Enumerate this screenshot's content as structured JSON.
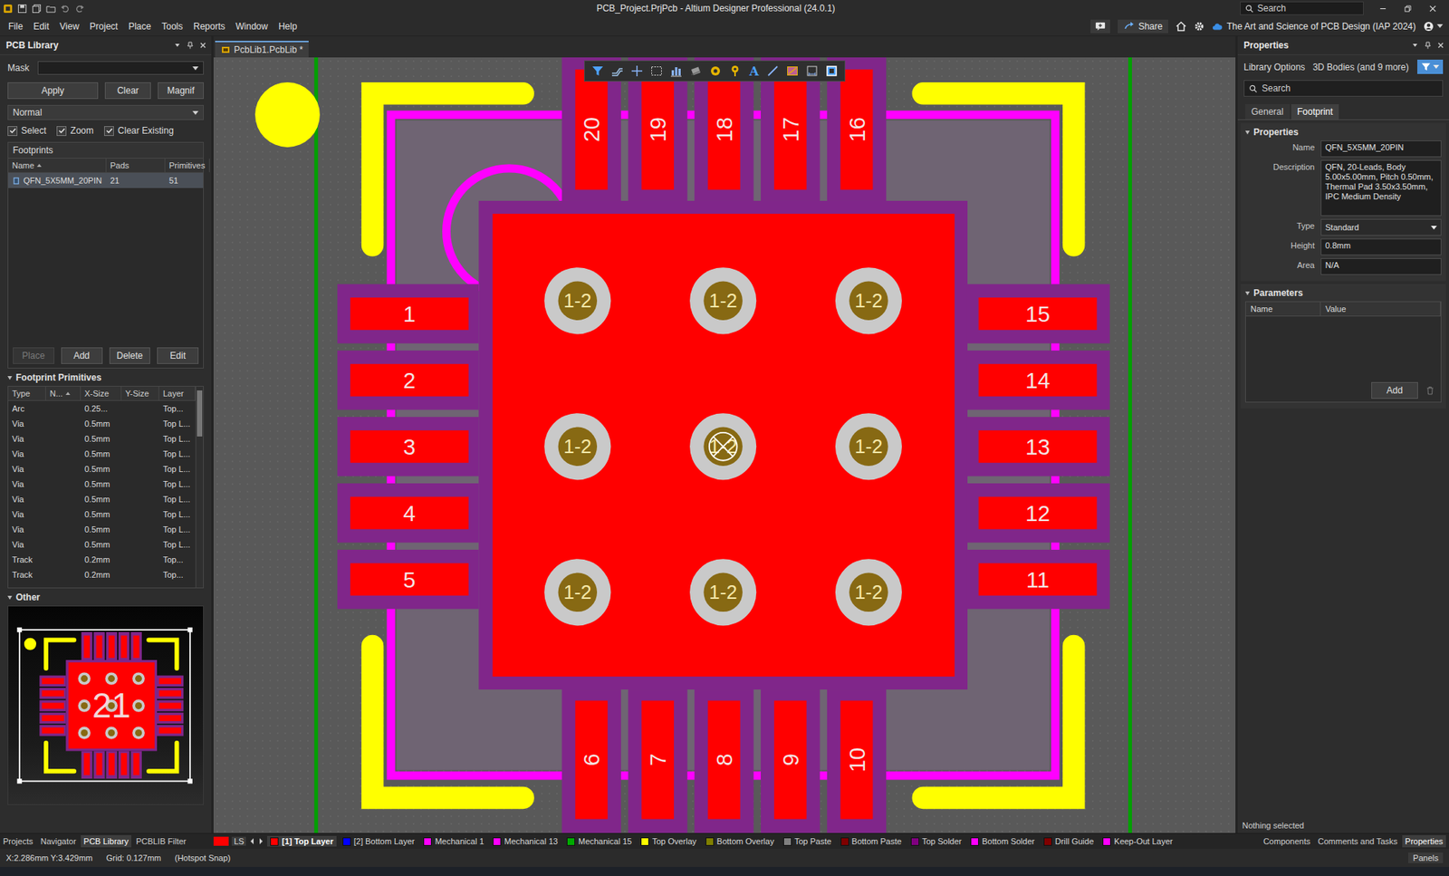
{
  "window": {
    "title": "PCB_Project.PrjPcb - Altium Designer Professional (24.0.1)",
    "search_placeholder": "Search"
  },
  "menu": [
    "File",
    "Edit",
    "View",
    "Project",
    "Place",
    "Tools",
    "Reports",
    "Window",
    "Help"
  ],
  "menu_right": {
    "share": "Share",
    "workspace": "The Art and Science of PCB Design (IAP 2024)"
  },
  "left_panel": {
    "title": "PCB Library",
    "mask_label": "Mask",
    "mask_value": "",
    "buttons": [
      "Apply",
      "Clear",
      "Magnif"
    ],
    "mode": "Normal",
    "options": [
      {
        "label": "Select",
        "checked": true
      },
      {
        "label": "Zoom",
        "checked": true
      },
      {
        "label": "Clear Existing",
        "checked": true
      }
    ],
    "footprints": {
      "title": "Footprints",
      "columns": [
        {
          "label": "Name",
          "sorted": true
        },
        {
          "label": "Pads",
          "sorted": false
        },
        {
          "label": "Primitives",
          "sorted": false
        }
      ],
      "rows": [
        {
          "name": "QFN_5X5MM_20PIN",
          "pads": "21",
          "primitives": "51",
          "selected": true
        }
      ],
      "buttons": [
        {
          "label": "Place",
          "disabled": true
        },
        {
          "label": "Add",
          "disabled": false
        },
        {
          "label": "Delete",
          "disabled": false
        },
        {
          "label": "Edit",
          "disabled": false
        }
      ]
    },
    "primitives": {
      "title": "Footprint Primitives",
      "columns": [
        {
          "label": "Type",
          "sorted": false
        },
        {
          "label": "N...",
          "sorted": true
        },
        {
          "label": "X-Size",
          "sorted": false
        },
        {
          "label": "Y-Size",
          "sorted": false
        },
        {
          "label": "Layer",
          "sorted": false
        }
      ],
      "rows": [
        {
          "type": "Arc",
          "name": "",
          "x_size": "0.25...",
          "y_size": "",
          "layer": "Top..."
        },
        {
          "type": "Via",
          "name": "",
          "x_size": "0.5mm",
          "y_size": "",
          "layer": "Top L..."
        },
        {
          "type": "Via",
          "name": "",
          "x_size": "0.5mm",
          "y_size": "",
          "layer": "Top L..."
        },
        {
          "type": "Via",
          "name": "",
          "x_size": "0.5mm",
          "y_size": "",
          "layer": "Top L..."
        },
        {
          "type": "Via",
          "name": "",
          "x_size": "0.5mm",
          "y_size": "",
          "layer": "Top L..."
        },
        {
          "type": "Via",
          "name": "",
          "x_size": "0.5mm",
          "y_size": "",
          "layer": "Top L..."
        },
        {
          "type": "Via",
          "name": "",
          "x_size": "0.5mm",
          "y_size": "",
          "layer": "Top L..."
        },
        {
          "type": "Via",
          "name": "",
          "x_size": "0.5mm",
          "y_size": "",
          "layer": "Top L..."
        },
        {
          "type": "Via",
          "name": "",
          "x_size": "0.5mm",
          "y_size": "",
          "layer": "Top L..."
        },
        {
          "type": "Via",
          "name": "",
          "x_size": "0.5mm",
          "y_size": "",
          "layer": "Top L..."
        },
        {
          "type": "Track",
          "name": "",
          "x_size": "0.2mm",
          "y_size": "",
          "layer": "Top..."
        },
        {
          "type": "Track",
          "name": "",
          "x_size": "0.2mm",
          "y_size": "",
          "layer": "Top..."
        }
      ],
      "scroll_position": 0.02,
      "scroll_visible_share": 0.23
    },
    "other_title": "Other"
  },
  "panel_tabs_left": [
    {
      "label": "Projects",
      "selected": false
    },
    {
      "label": "Navigator",
      "selected": false
    },
    {
      "label": "PCB Library",
      "selected": true
    },
    {
      "label": "PCBLIB Filter",
      "selected": false
    }
  ],
  "document_tabs": [
    {
      "label": "PcbLib1.PcbLib *",
      "selected": true
    }
  ],
  "canvas": {
    "text_tool": "A",
    "thermal_pad": "21",
    "pads": [
      {
        "number": "1",
        "side": "left"
      },
      {
        "number": "2",
        "side": "left"
      },
      {
        "number": "3",
        "side": "left"
      },
      {
        "number": "4",
        "side": "left"
      },
      {
        "number": "5",
        "side": "left"
      },
      {
        "number": "6",
        "side": "bottom"
      },
      {
        "number": "7",
        "side": "bottom"
      },
      {
        "number": "8",
        "side": "bottom"
      },
      {
        "number": "9",
        "side": "bottom"
      },
      {
        "number": "10",
        "side": "bottom"
      },
      {
        "number": "11",
        "side": "right"
      },
      {
        "number": "12",
        "side": "right"
      },
      {
        "number": "13",
        "side": "right"
      },
      {
        "number": "14",
        "side": "right"
      },
      {
        "number": "15",
        "side": "right"
      },
      {
        "number": "16",
        "side": "top"
      },
      {
        "number": "17",
        "side": "top"
      },
      {
        "number": "18",
        "side": "top"
      },
      {
        "number": "19",
        "side": "top"
      },
      {
        "number": "20",
        "side": "top"
      }
    ],
    "vias": [
      {
        "label": "1-2",
        "snapped": false
      },
      {
        "label": "1-2",
        "snapped": false
      },
      {
        "label": "1-2",
        "snapped": false
      },
      {
        "label": "1-2",
        "snapped": false
      },
      {
        "label": "1-2",
        "snapped": true
      },
      {
        "label": "1-2",
        "snapped": false
      },
      {
        "label": "1-2",
        "snapped": false
      },
      {
        "label": "1-2",
        "snapped": false
      },
      {
        "label": "1-2",
        "snapped": false
      }
    ]
  },
  "layer_bar": {
    "current_color": "#ff0000",
    "set_label": "LS",
    "layers": [
      {
        "label": "[1] Top Layer",
        "color": "#ff0000",
        "selected": true
      },
      {
        "label": "[2] Bottom Layer",
        "color": "#0000ff",
        "selected": false
      },
      {
        "label": "Mechanical 1",
        "color": "#ff00ff",
        "selected": false
      },
      {
        "label": "Mechanical 13",
        "color": "#ff00ff",
        "selected": false
      },
      {
        "label": "Mechanical 15",
        "color": "#00aa00",
        "selected": false
      },
      {
        "label": "Top Overlay",
        "color": "#ffff00",
        "selected": false
      },
      {
        "label": "Bottom Overlay",
        "color": "#808000",
        "selected": false
      },
      {
        "label": "Top Paste",
        "color": "#808080",
        "selected": false
      },
      {
        "label": "Bottom Paste",
        "color": "#800000",
        "selected": false
      },
      {
        "label": "Top Solder",
        "color": "#800080",
        "selected": false
      },
      {
        "label": "Bottom Solder",
        "color": "#ff00ff",
        "selected": false
      },
      {
        "label": "Drill Guide",
        "color": "#800000",
        "selected": false
      },
      {
        "label": "Keep-Out Layer",
        "color": "#ff00ff",
        "selected": false
      }
    ]
  },
  "right_panel": {
    "title": "Properties",
    "scope": "Library Options",
    "filter": "3D Bodies (and 9 more)",
    "search_placeholder": "Search",
    "tabs": [
      {
        "label": "General",
        "selected": false
      },
      {
        "label": "Footprint",
        "selected": true
      }
    ],
    "section": "Properties",
    "fields": [
      {
        "label": "Name",
        "value": "QFN_5X5MM_20PIN",
        "kind": "text"
      },
      {
        "label": "Description",
        "value": "QFN, 20-Leads, Body 5.00x5.00mm, Pitch 0.50mm, Thermal Pad 3.50x3.50mm, IPC Medium Density",
        "kind": "textarea"
      },
      {
        "label": "Type",
        "value": "Standard",
        "kind": "select"
      },
      {
        "label": "Height",
        "value": "0.8mm",
        "kind": "text"
      },
      {
        "label": "Area",
        "value": "N/A",
        "kind": "text"
      }
    ],
    "parameters": {
      "title": "Parameters",
      "columns": [
        "Name",
        "Value"
      ],
      "add": "Add"
    },
    "selection": "Nothing selected"
  },
  "panel_tabs_right": [
    {
      "label": "Components",
      "selected": false
    },
    {
      "label": "Comments and Tasks",
      "selected": false
    },
    {
      "label": "Properties",
      "selected": true
    }
  ],
  "status_bar": {
    "coords": "X:2.286mm Y:3.429mm",
    "grid": "Grid: 0.127mm",
    "snap": "(Hotspot Snap)",
    "panels": "Panels"
  }
}
